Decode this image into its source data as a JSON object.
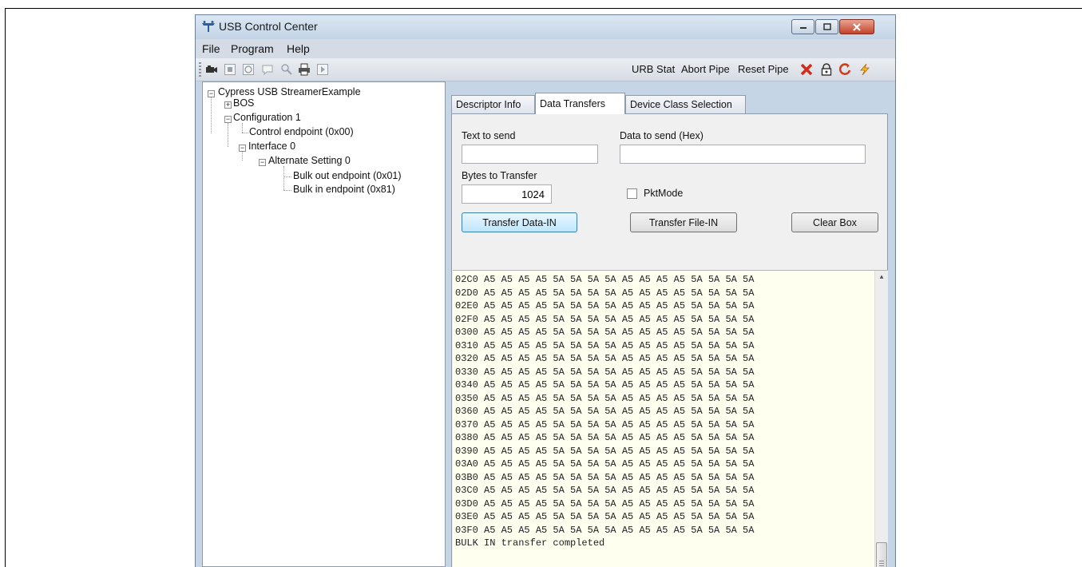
{
  "window": {
    "title": "USB Control Center",
    "accent_color": "#c6d5e6"
  },
  "menu": [
    {
      "label": "File"
    },
    {
      "label": "Program"
    },
    {
      "label": "Help"
    }
  ],
  "toolbar": {
    "icons": [
      "camera-icon",
      "stop-icon",
      "refresh-icon",
      "comment-icon",
      "search-icon",
      "print-icon",
      "play-icon"
    ],
    "urb_stat_label": "URB Stat",
    "abort_pipe_label": "Abort Pipe",
    "reset_pipe_label": "Reset Pipe",
    "right_icons": [
      "red-x-icon",
      "lock-icon",
      "power-cycle-icon",
      "lightning-icon"
    ]
  },
  "tree": {
    "root": "Cypress USB StreamerExample",
    "bos": "BOS",
    "configuration": "Configuration 1",
    "control_endpoint": "Control endpoint (0x00)",
    "interface": "Interface 0",
    "alt_setting": "Alternate Setting 0",
    "bulk_out": "Bulk out endpoint (0x01)",
    "bulk_in": "Bulk in endpoint (0x81)"
  },
  "tabs": [
    {
      "label": "Descriptor Info"
    },
    {
      "label": "Data Transfers",
      "active": true
    },
    {
      "label": "Device Class Selection"
    }
  ],
  "data_transfers": {
    "text_to_send_label": "Text to send",
    "text_to_send_value": "",
    "hex_to_send_label": "Data to send (Hex)",
    "hex_to_send_value": "",
    "bytes_label": "Bytes to Transfer",
    "bytes_value": "1024",
    "pktmode_label": "PktMode",
    "pktmode_checked": false,
    "transfer_in_label": "Transfer Data-IN",
    "transfer_file_label": "Transfer File-IN",
    "clear_box_label": "Clear Box",
    "output_lines": [
      "02C0 A5 A5 A5 A5 5A 5A 5A 5A A5 A5 A5 A5 5A 5A 5A 5A",
      "02D0 A5 A5 A5 A5 5A 5A 5A 5A A5 A5 A5 A5 5A 5A 5A 5A",
      "02E0 A5 A5 A5 A5 5A 5A 5A 5A A5 A5 A5 A5 5A 5A 5A 5A",
      "02F0 A5 A5 A5 A5 5A 5A 5A 5A A5 A5 A5 A5 5A 5A 5A 5A",
      "0300 A5 A5 A5 A5 5A 5A 5A 5A A5 A5 A5 A5 5A 5A 5A 5A",
      "0310 A5 A5 A5 A5 5A 5A 5A 5A A5 A5 A5 A5 5A 5A 5A 5A",
      "0320 A5 A5 A5 A5 5A 5A 5A 5A A5 A5 A5 A5 5A 5A 5A 5A",
      "0330 A5 A5 A5 A5 5A 5A 5A 5A A5 A5 A5 A5 5A 5A 5A 5A",
      "0340 A5 A5 A5 A5 5A 5A 5A 5A A5 A5 A5 A5 5A 5A 5A 5A",
      "0350 A5 A5 A5 A5 5A 5A 5A 5A A5 A5 A5 A5 5A 5A 5A 5A",
      "0360 A5 A5 A5 A5 5A 5A 5A 5A A5 A5 A5 A5 5A 5A 5A 5A",
      "0370 A5 A5 A5 A5 5A 5A 5A 5A A5 A5 A5 A5 5A 5A 5A 5A",
      "0380 A5 A5 A5 A5 5A 5A 5A 5A A5 A5 A5 A5 5A 5A 5A 5A",
      "0390 A5 A5 A5 A5 5A 5A 5A 5A A5 A5 A5 A5 5A 5A 5A 5A",
      "03A0 A5 A5 A5 A5 5A 5A 5A 5A A5 A5 A5 A5 5A 5A 5A 5A",
      "03B0 A5 A5 A5 A5 5A 5A 5A 5A A5 A5 A5 A5 5A 5A 5A 5A",
      "03C0 A5 A5 A5 A5 5A 5A 5A 5A A5 A5 A5 A5 5A 5A 5A 5A",
      "03D0 A5 A5 A5 A5 5A 5A 5A 5A A5 A5 A5 A5 5A 5A 5A 5A",
      "03E0 A5 A5 A5 A5 5A 5A 5A 5A A5 A5 A5 A5 5A 5A 5A 5A",
      "03F0 A5 A5 A5 A5 5A 5A 5A 5A A5 A5 A5 A5 5A 5A 5A 5A",
      "BULK IN transfer completed"
    ]
  }
}
